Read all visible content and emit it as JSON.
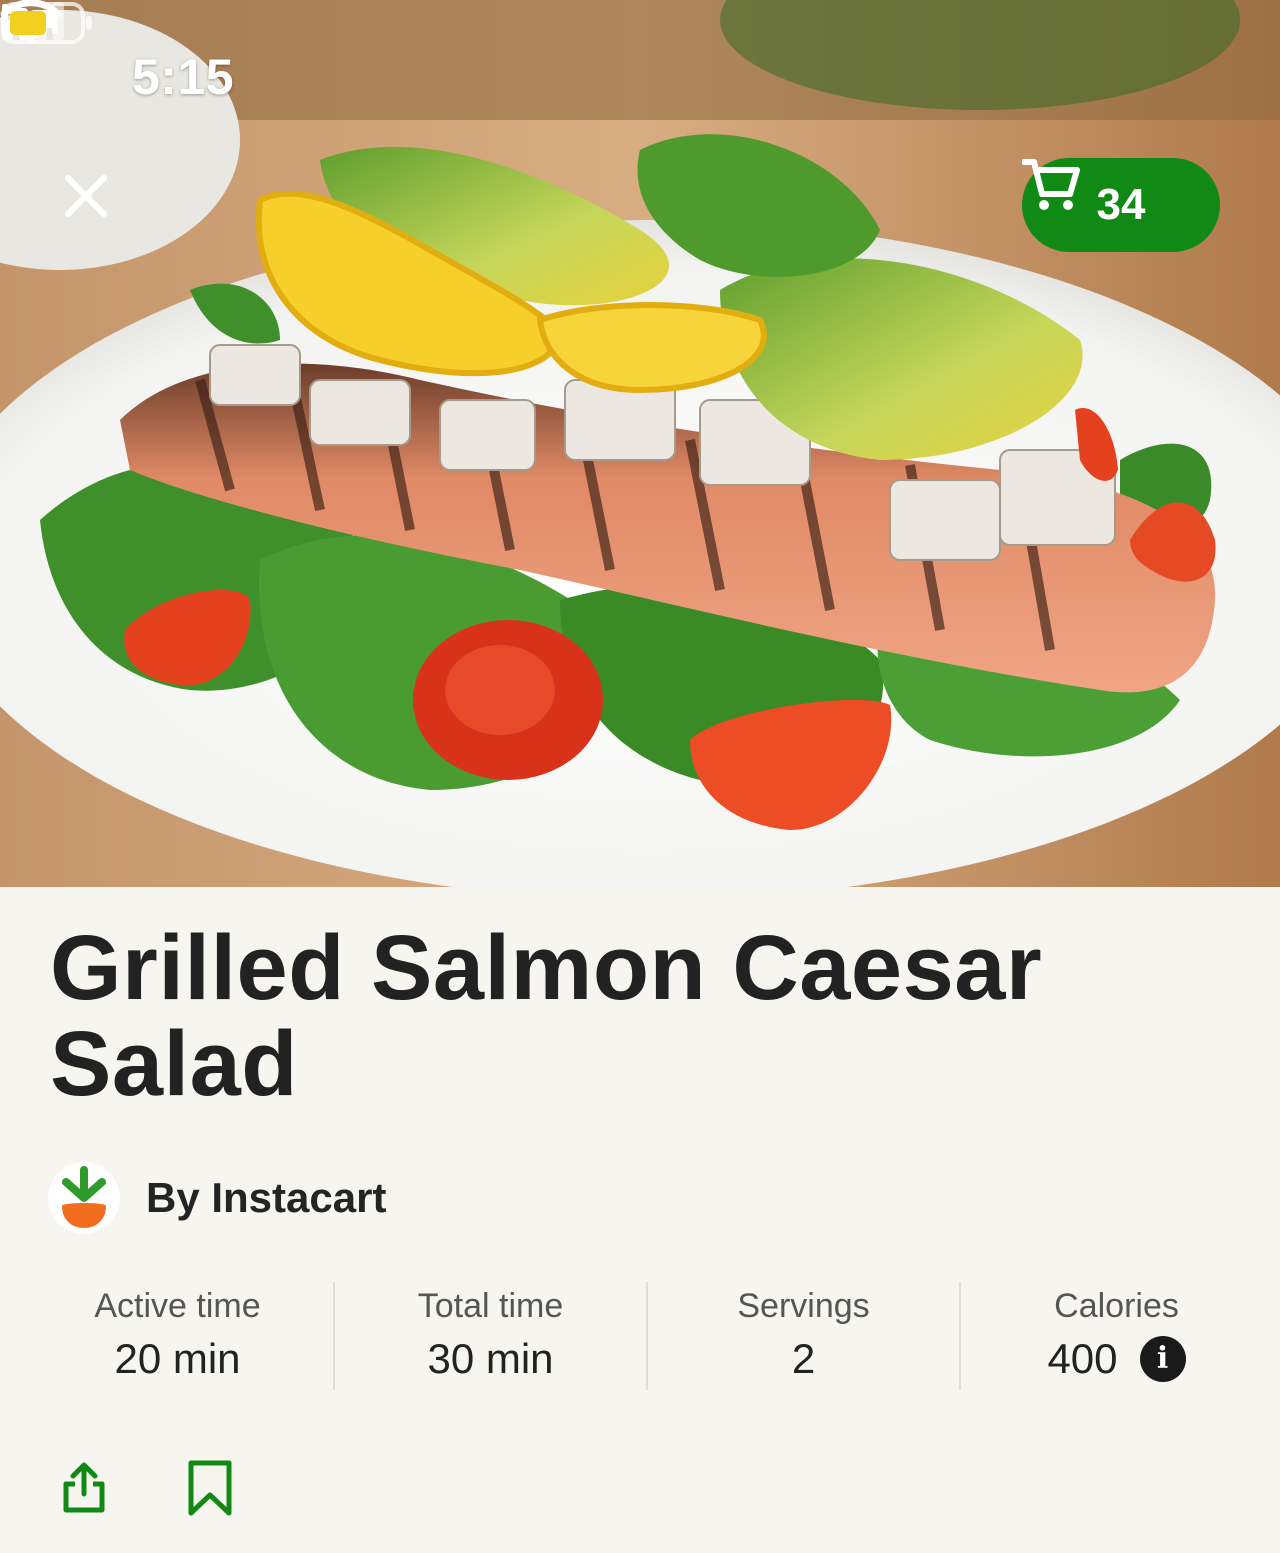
{
  "status_bar": {
    "time": "5:15",
    "icons": [
      "bed-icon",
      "signal-icon",
      "wifi-icon",
      "battery-icon"
    ],
    "battery_color": "#f2d01e"
  },
  "header": {
    "close_icon": "close-icon",
    "cart": {
      "icon": "cart-icon",
      "count": "34",
      "color": "#108a14"
    }
  },
  "hero_image": {
    "description_icon": "grilled-salmon-salad-photo"
  },
  "recipe": {
    "title": "Grilled Salmon Caesar Salad",
    "author": {
      "name": "By Instacart",
      "avatar_icon": "instacart-carrot-logo"
    },
    "stats": [
      {
        "label": "Active time",
        "value": "20 min"
      },
      {
        "label": "Total time",
        "value": "30 min"
      },
      {
        "label": "Servings",
        "value": "2"
      },
      {
        "label": "Calories",
        "value": "400",
        "icon": "info-icon"
      }
    ]
  },
  "actions": {
    "share_icon": "share-icon",
    "bookmark_icon": "bookmark-icon",
    "color": "#108a14"
  }
}
